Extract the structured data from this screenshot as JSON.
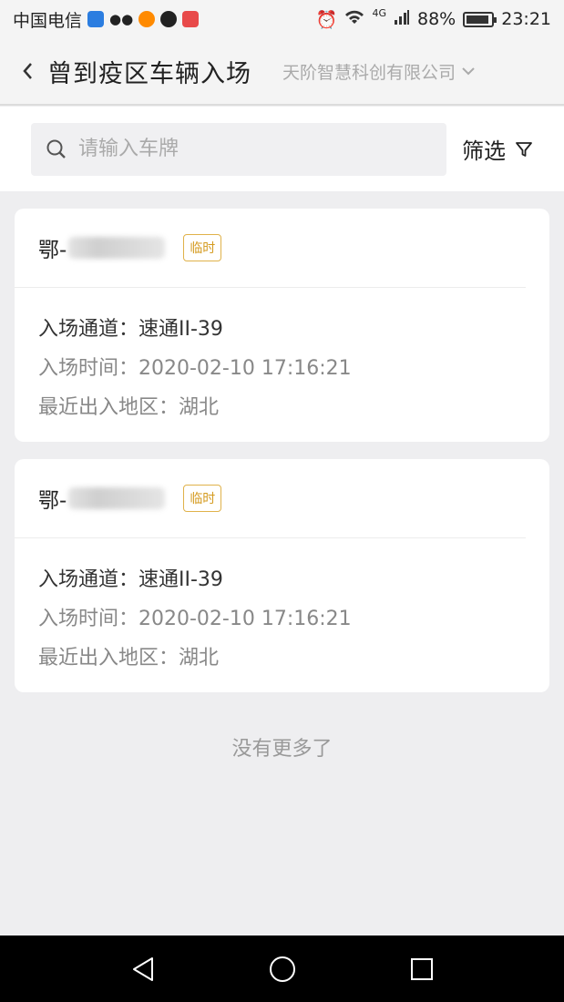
{
  "status_bar": {
    "carrier": "中国电信",
    "network": "4G",
    "battery": "88%",
    "time": "23:21"
  },
  "header": {
    "title": "曾到疫区车辆入场",
    "company": "天阶智慧科创有限公司"
  },
  "search": {
    "placeholder": "请输入车牌",
    "filter_label": "筛选"
  },
  "records": [
    {
      "plate_prefix": "鄂-",
      "badge": "临时",
      "channel": "入场通道：速通II-39",
      "time": "入场时间：2020-02-10 17:16:21",
      "region": "最近出入地区：湖北"
    },
    {
      "plate_prefix": "鄂-",
      "badge": "临时",
      "channel": "入场通道：速通II-39",
      "time": "入场时间：2020-02-10 17:16:21",
      "region": "最近出入地区：湖北"
    }
  ],
  "footer": {
    "no_more": "没有更多了"
  },
  "colors": {
    "badge": "#e0b24a",
    "background": "#eeeef0"
  }
}
